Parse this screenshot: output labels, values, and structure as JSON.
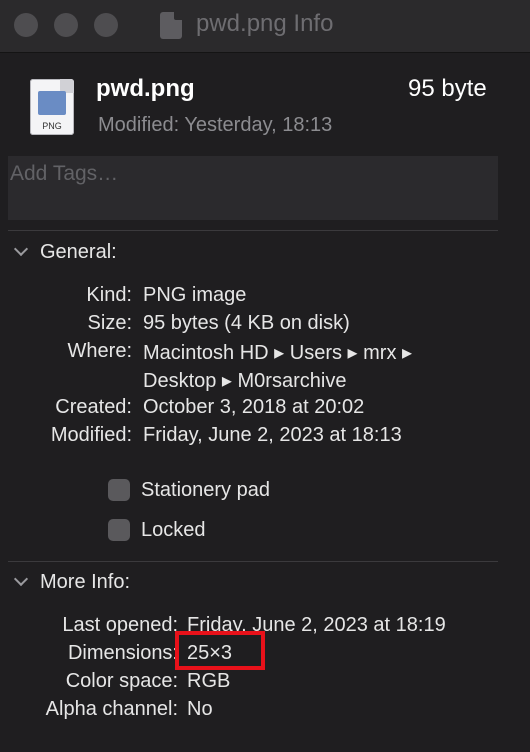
{
  "window": {
    "title": "pwd.png Info"
  },
  "header": {
    "file_name": "pwd.png",
    "file_size": "95 byte",
    "modified_label": "Modified:",
    "modified_value": "Yesterday, 18:13",
    "icon_ext": "PNG"
  },
  "tags": {
    "placeholder": "Add Tags…"
  },
  "general": {
    "title": "General:",
    "rows": [
      {
        "label": "Kind:",
        "value": "PNG image"
      },
      {
        "label": "Size:",
        "value": "95 bytes (4 KB on disk)"
      },
      {
        "label": "Where:",
        "value": "Macintosh HD ▸ Users ▸ mrx ▸"
      },
      {
        "label": "",
        "value": "Desktop ▸ M0rsarchive"
      },
      {
        "label": "Created:",
        "value": "October 3, 2018 at 20:02"
      },
      {
        "label": "Modified:",
        "value": "Friday, June 2, 2023 at 18:13"
      }
    ],
    "stationery_label": "Stationery pad",
    "locked_label": "Locked"
  },
  "more_info": {
    "title": "More Info:",
    "rows": [
      {
        "label": "Last opened:",
        "value": "Friday, June 2, 2023 at 18:19"
      },
      {
        "label": "Dimensions:",
        "value": "25×3"
      },
      {
        "label": "Color space:",
        "value": "RGB"
      },
      {
        "label": "Alpha channel:",
        "value": "No"
      }
    ]
  },
  "colors": {
    "highlight": "#e8111a",
    "background": "#1f1e20"
  }
}
